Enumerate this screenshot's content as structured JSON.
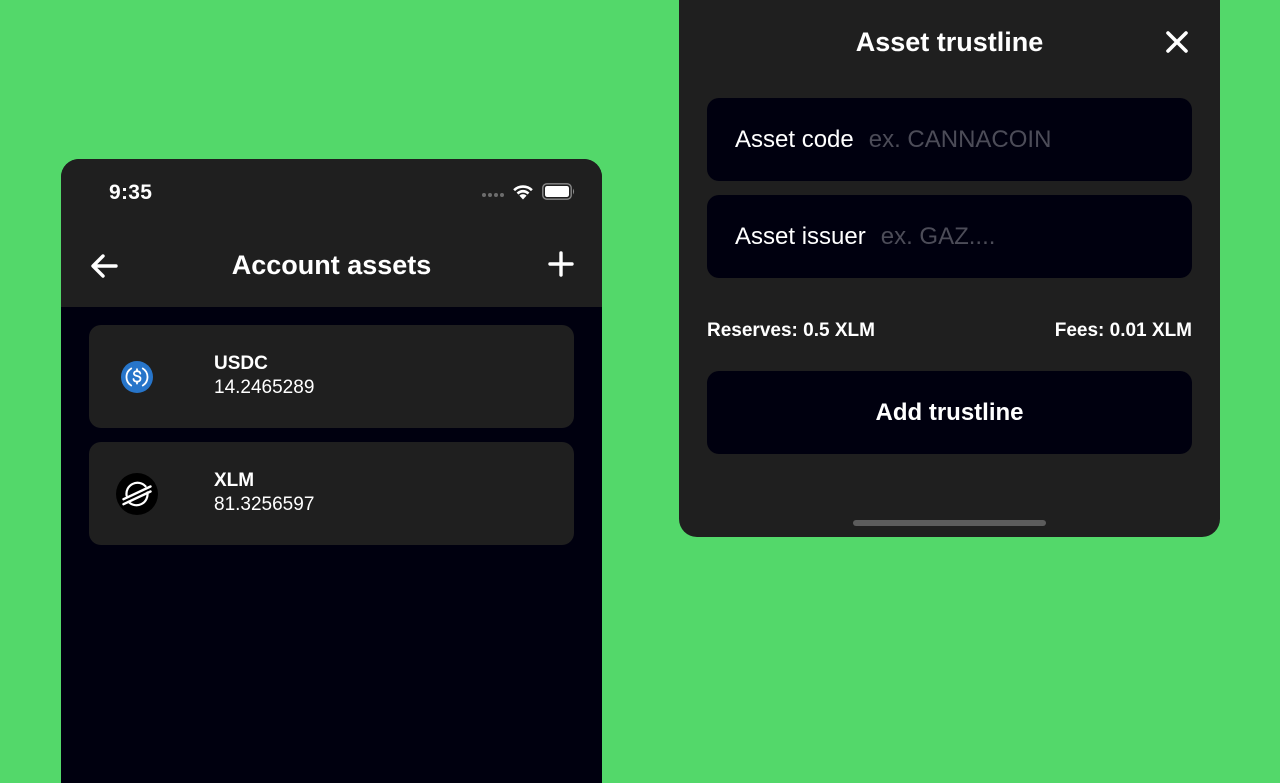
{
  "phone": {
    "status_time": "9:35",
    "title": "Account assets",
    "back_icon": "arrow-left-icon",
    "add_icon": "plus-icon",
    "assets": [
      {
        "code": "USDC",
        "balance": "14.2465289",
        "icon": "usdc-icon"
      },
      {
        "code": "XLM",
        "balance": "81.3256597",
        "icon": "stellar-icon"
      }
    ]
  },
  "modal": {
    "title": "Asset trustline",
    "close_icon": "close-icon",
    "asset_code": {
      "label": "Asset code",
      "value": "",
      "placeholder": "ex. CANNACOIN"
    },
    "asset_issuer": {
      "label": "Asset issuer",
      "value": "",
      "placeholder": "ex. GAZ...."
    },
    "reserves": "Reserves: 0.5 XLM",
    "fees": "Fees: 0.01 XLM",
    "add_button": "Add trustline"
  },
  "colors": {
    "background": "#53d86a",
    "surface": "#1f1f1f",
    "deep": "#00000f",
    "usdc_blue": "#2775ca",
    "text": "#ffffff",
    "placeholder": "#4c4c58"
  }
}
